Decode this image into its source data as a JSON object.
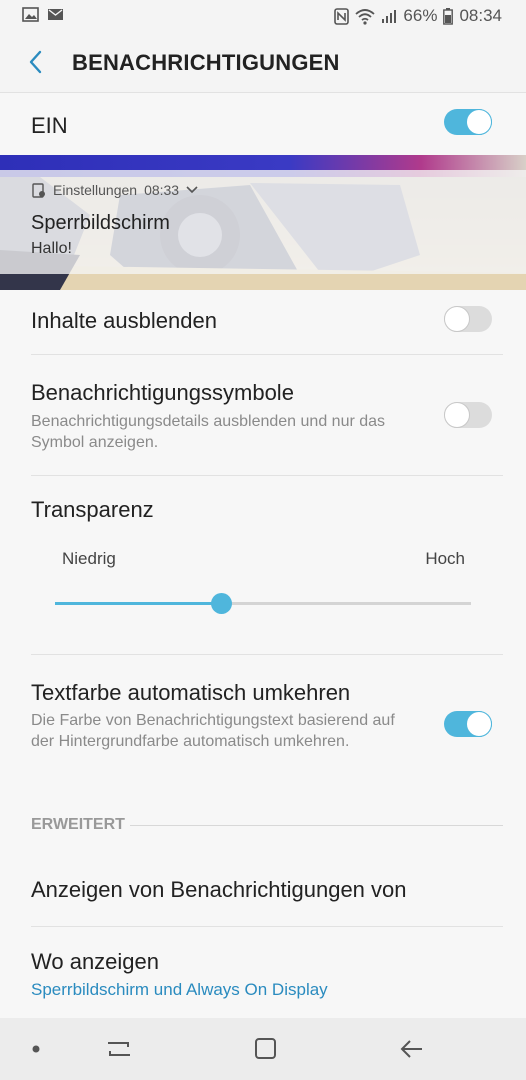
{
  "status_bar": {
    "battery": "66%",
    "time": "08:34",
    "icons": [
      "gallery-icon",
      "mail-icon",
      "nfc-icon",
      "wifi-icon",
      "signal-icon",
      "battery-icon"
    ]
  },
  "app_bar": {
    "title": "BENACHRICHTIGUNGEN",
    "back_icon": "back-arrow-icon"
  },
  "master_switch": {
    "label": "EIN",
    "state": "on"
  },
  "preview": {
    "app_name": "Einstellungen",
    "time": "08:33",
    "title": "Sperrbildschirm",
    "text": "Hallo!"
  },
  "settings": {
    "hide_content": {
      "title": "Inhalte ausblenden",
      "state": "off"
    },
    "notification_icons": {
      "title": "Benachrichtigungssymbole",
      "subtitle": "Benachrichtigungsdetails ausblenden und nur das Symbol anzeigen.",
      "state": "off"
    },
    "transparency": {
      "title": "Transparenz",
      "low_label": "Niedrig",
      "high_label": "Hoch",
      "value_fraction": 0.4
    },
    "invert_text": {
      "title": "Textfarbe automatisch umkehren",
      "subtitle": "Die Farbe von Benachrichtigungstext basierend auf der Hintergrundfarbe automatisch umkehren.",
      "state": "on"
    }
  },
  "advanced": {
    "header": "ERWEITERT",
    "show_from": {
      "title": "Anzeigen von Benachrichtigungen von"
    },
    "where": {
      "title": "Wo anzeigen",
      "value": "Sperrbildschirm und Always On Display"
    }
  },
  "nav_bar": {
    "icons": [
      "dot-icon",
      "recent-apps-icon",
      "home-icon",
      "back-icon"
    ]
  },
  "colors": {
    "accent": "#4fb6dc",
    "link": "#2a8bbf",
    "background": "#f7f7f7"
  }
}
